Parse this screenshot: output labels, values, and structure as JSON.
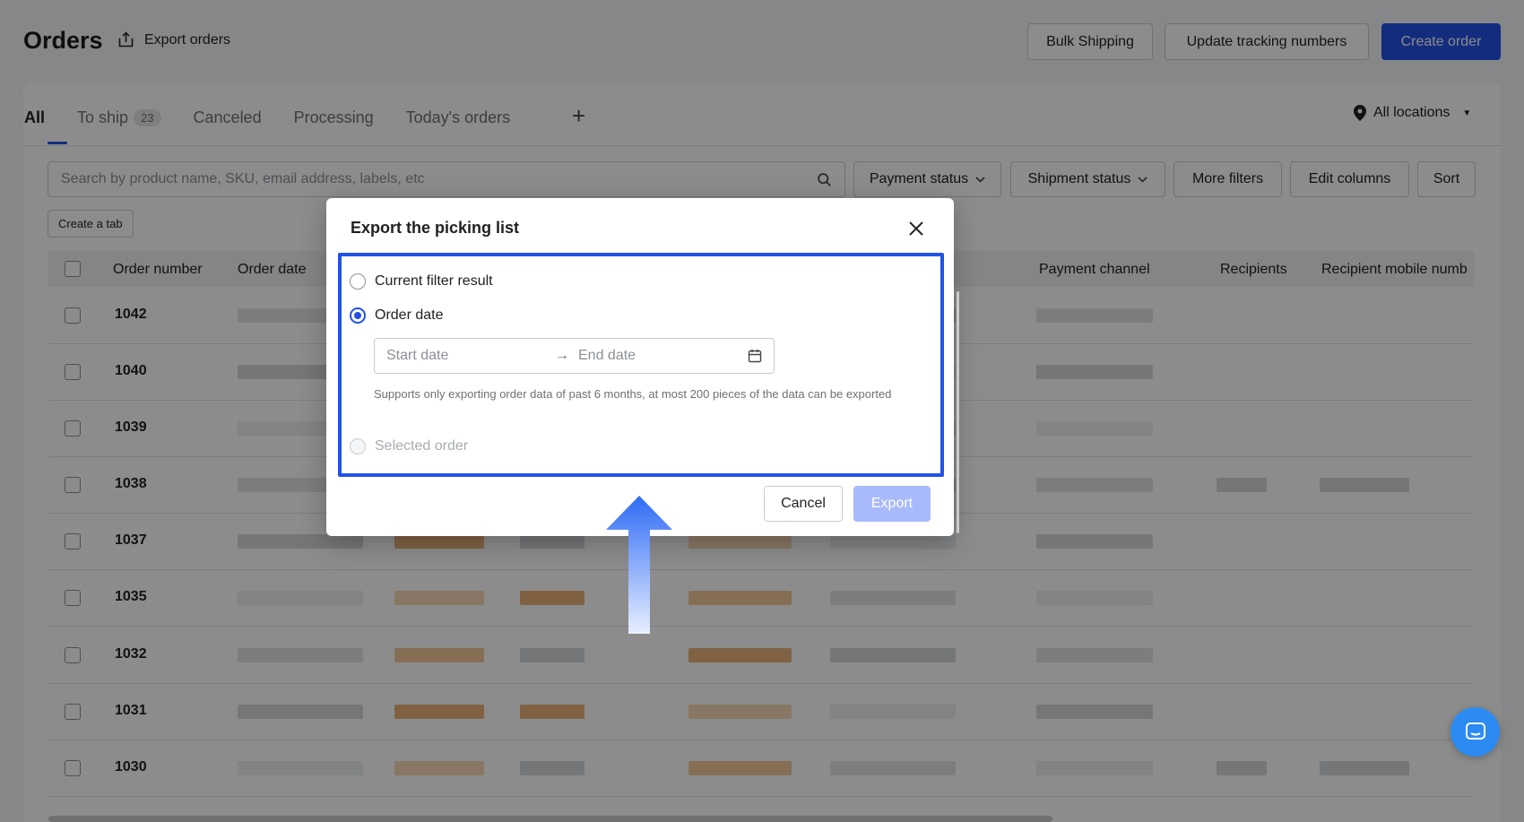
{
  "header": {
    "title": "Orders",
    "export_orders": "Export orders",
    "bulk_shipping": "Bulk Shipping",
    "update_tracking": "Update tracking numbers",
    "create_order": "Create order"
  },
  "tabs": [
    {
      "label": "All",
      "active": true
    },
    {
      "label": "To ship",
      "count": "23"
    },
    {
      "label": "Canceled"
    },
    {
      "label": "Processing"
    },
    {
      "label": "Today's orders"
    }
  ],
  "add_tab": "+",
  "locations": "All locations",
  "search": {
    "placeholder": "Search by product name, SKU, email address, labels, etc"
  },
  "filters": {
    "payment_status": "Payment status",
    "shipment_status": "Shipment status",
    "more_filters": "More filters",
    "edit_columns": "Edit columns",
    "sort": "Sort"
  },
  "create_tab": "Create a tab",
  "table": {
    "columns": [
      "Order number",
      "Order date",
      "Payment channel",
      "Recipients",
      "Recipient mobile numb"
    ],
    "rows": [
      "1042",
      "1040",
      "1039",
      "1038",
      "1037",
      "1035",
      "1032",
      "1031",
      "1030"
    ]
  },
  "modal": {
    "title": "Export the picking list",
    "options": [
      {
        "label": "Current filter result",
        "checked": false,
        "disabled": false
      },
      {
        "label": "Order date",
        "checked": true,
        "disabled": false
      },
      {
        "label": "Selected order",
        "checked": false,
        "disabled": true
      }
    ],
    "start_placeholder": "Start date",
    "end_placeholder": "End date",
    "arrow": "→",
    "hint": "Supports only exporting order data of past 6 months, at most 200 pieces of the data can be exported",
    "cancel": "Cancel",
    "export": "Export"
  },
  "colors": {
    "primary": "#2350e6",
    "highlight": "#2153e6",
    "export_disabled": "#a8bafc",
    "chat": "#2b8bf2"
  }
}
